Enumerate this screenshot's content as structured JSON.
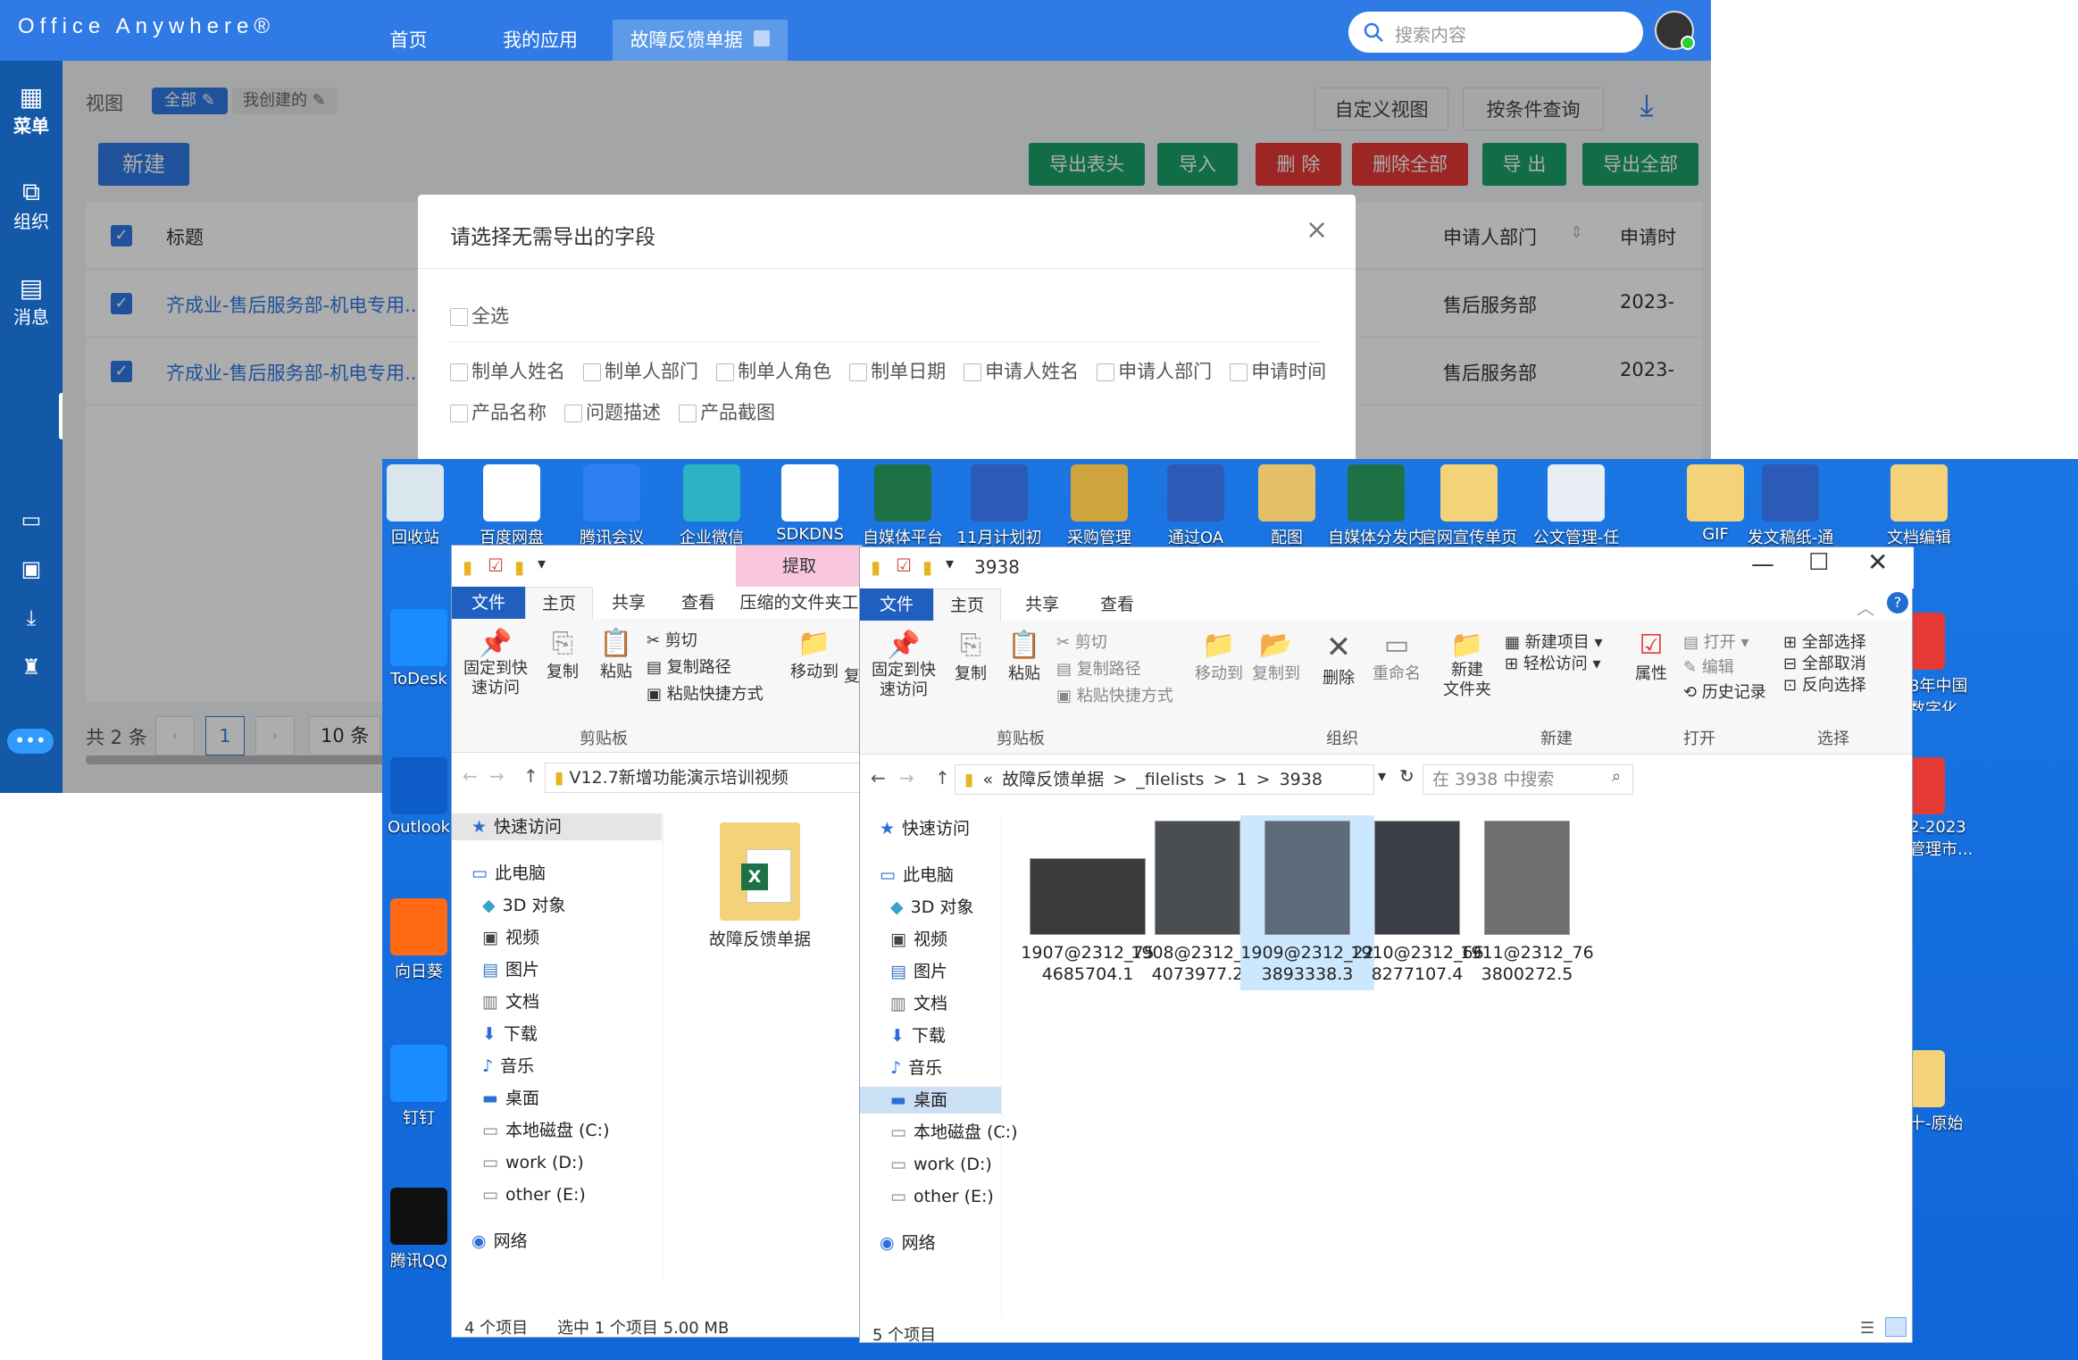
{
  "oa": {
    "logo": "Office Anywhere®",
    "nav_tabs": [
      "首页",
      "我的应用",
      "故障反馈单据"
    ],
    "search_placeholder": "搜索内容",
    "rail": [
      "菜单",
      "组织",
      "消息"
    ],
    "view_label": "视图",
    "view_all": "全部",
    "view_mine": "我创建的",
    "btn_custom_view": "自定义视图",
    "btn_query": "按条件查询",
    "btn_new": "新建",
    "btn_export_header": "导出表头",
    "btn_import": "导入",
    "btn_delete": "删 除",
    "btn_delete_all": "删除全部",
    "btn_export": "导 出",
    "btn_export_all": "导出全部",
    "table": {
      "col_title": "标题",
      "col_dept": "申请人部门",
      "col_time": "申请时",
      "rows": [
        {
          "title": "齐成业-售后服务部-机电专用...",
          "dept": "售后服务部",
          "date": "2023-"
        },
        {
          "title": "齐成业-售后服务部-机电专用...",
          "dept": "售后服务部",
          "date": "2023-"
        }
      ]
    },
    "pager": {
      "total": "共 2 条",
      "page": "1",
      "size": "10 条"
    }
  },
  "modal": {
    "title": "请选择无需导出的字段",
    "select_all": "全选",
    "fields_row1": [
      "制单人姓名",
      "制单人部门",
      "制单人角色",
      "制单日期",
      "申请人姓名",
      "申请人部门",
      "申请时间"
    ],
    "fields_row2": [
      "产品名称",
      "问题描述",
      "产品截图"
    ]
  },
  "desktop": {
    "top_icons": [
      "回收站",
      "百度网盘",
      "腾讯会议",
      "企业微信",
      "SDKDNS",
      "自媒体平台",
      "11月计划初",
      "采购管理",
      "通过OA",
      "配图",
      "自媒体分发内",
      "官网宣传单页",
      "公文管理-任",
      "GIF",
      "发文稿纸-通",
      "文档编辑"
    ],
    "left_icons": [
      "ToDesk",
      "Outlook",
      "向日葵",
      "钉钉",
      "腾讯QQ"
    ],
    "right_icons": [
      "3年中国\n数字化...",
      "2-2023\n管理市...",
      "十-原始"
    ]
  },
  "explorer_left": {
    "tab_extract": "提取",
    "menu": [
      "文件",
      "主页",
      "共享",
      "查看",
      "压缩的文件夹工"
    ],
    "ribbon": {
      "pin": "固定到快\n速访问",
      "copy": "复制",
      "paste": "粘贴",
      "cut": "剪切",
      "copy_path": "复制路径",
      "paste_shortcut": "粘贴快捷方式",
      "move_to": "移动到",
      "copy_to": "复",
      "group_clipboard": "剪贴板"
    },
    "address": "V12.7新增功能演示培训视频",
    "nav": [
      "快速访问",
      "此电脑",
      "3D 对象",
      "视频",
      "图片",
      "文档",
      "下载",
      "音乐",
      "桌面",
      "本地磁盘 (C:)",
      "work (D:)",
      "other (E:)",
      "网络"
    ],
    "file": "故障反馈单据",
    "status_count": "4 个项目",
    "status_sel": "选中 1 个项目  5.00 MB"
  },
  "explorer_right": {
    "title": "3938",
    "menu": [
      "文件",
      "主页",
      "共享",
      "查看"
    ],
    "ribbon": {
      "pin": "固定到快\n速访问",
      "copy": "复制",
      "paste": "粘贴",
      "cut": "剪切",
      "copy_path": "复制路径",
      "paste_shortcut": "粘贴快捷方式",
      "move_to": "移动到",
      "copy_to": "复制到",
      "delete": "删除",
      "rename": "重命名",
      "new_folder": "新建\n文件夹",
      "new_item": "新建项目",
      "easy_access": "轻松访问",
      "properties": "属性",
      "open": "打开",
      "edit": "编辑",
      "history": "历史记录",
      "select_all": "全部选择",
      "select_none": "全部取消",
      "invert": "反向选择"
    },
    "groups": [
      "剪贴板",
      "组织",
      "新建",
      "打开",
      "选择"
    ],
    "breadcrumb": [
      "«",
      "故障反馈单据",
      ">",
      "_filelists",
      ">",
      "1",
      ">",
      "3938"
    ],
    "search_placeholder": "在 3938 中搜索",
    "nav": [
      "快速访问",
      "此电脑",
      "3D 对象",
      "视频",
      "图片",
      "文档",
      "下载",
      "音乐",
      "桌面",
      "本地磁盘 (C:)",
      "work (D:)",
      "other (E:)",
      "网络"
    ],
    "files": [
      "1907@2312_75\n4685704.1",
      "1908@2312_30\n4073977.2",
      "1909@2312_22\n3893338.3",
      "1910@2312_66\n8277107.4",
      "1911@2312_76\n3800272.5"
    ],
    "status": "5 个项目"
  }
}
